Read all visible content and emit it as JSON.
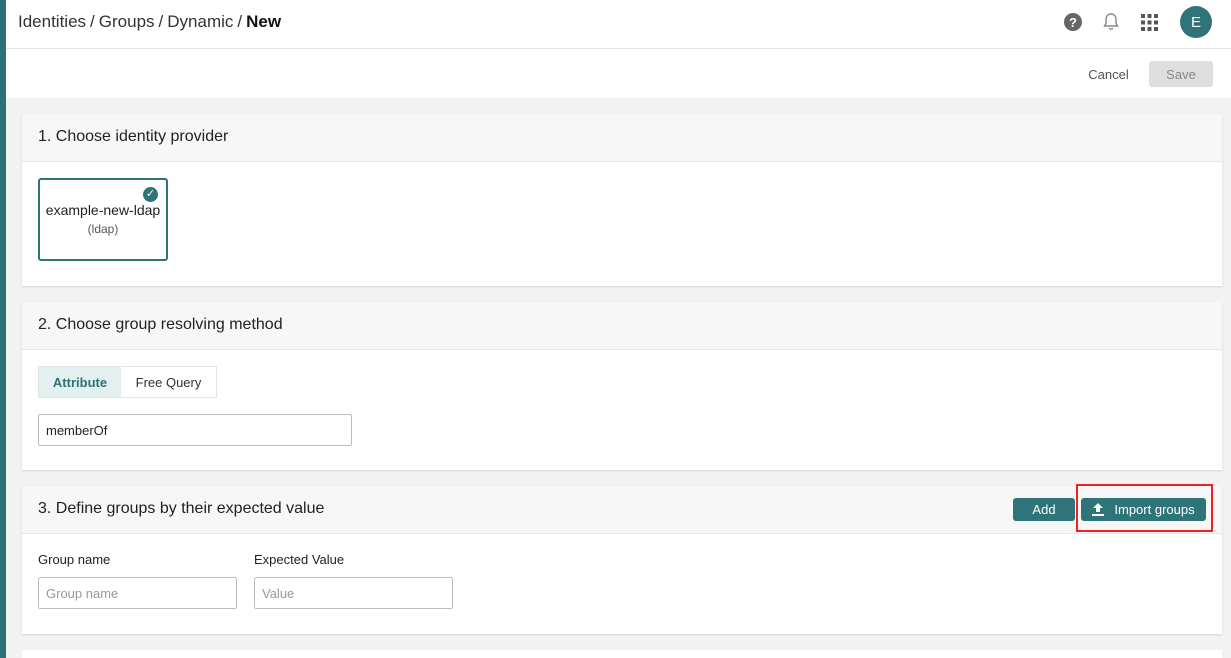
{
  "header": {
    "breadcrumb": [
      "Identities",
      "Groups",
      "Dynamic",
      "New"
    ],
    "separator": "/",
    "avatar_initial": "E",
    "icons": [
      "help-icon",
      "bell-icon",
      "apps-grid-icon"
    ]
  },
  "toolbar": {
    "cancel_label": "Cancel",
    "save_label": "Save"
  },
  "section1": {
    "title": "1. Choose identity provider",
    "provider_name": "example-new-ldap",
    "provider_type": "(ldap)"
  },
  "section2": {
    "title": "2. Choose group resolving method",
    "tabs": [
      "Attribute",
      "Free Query"
    ],
    "active_tab": "Attribute",
    "attribute_value": "memberOf"
  },
  "section3": {
    "title": "3. Define groups by their expected value",
    "add_label": "Add",
    "import_label": "Import groups",
    "group_name_label": "Group name",
    "group_name_placeholder": "Group name",
    "expected_value_label": "Expected Value",
    "expected_value_placeholder": "Value"
  },
  "colors": {
    "accent": "#2f7478",
    "highlight": "#e22222"
  }
}
